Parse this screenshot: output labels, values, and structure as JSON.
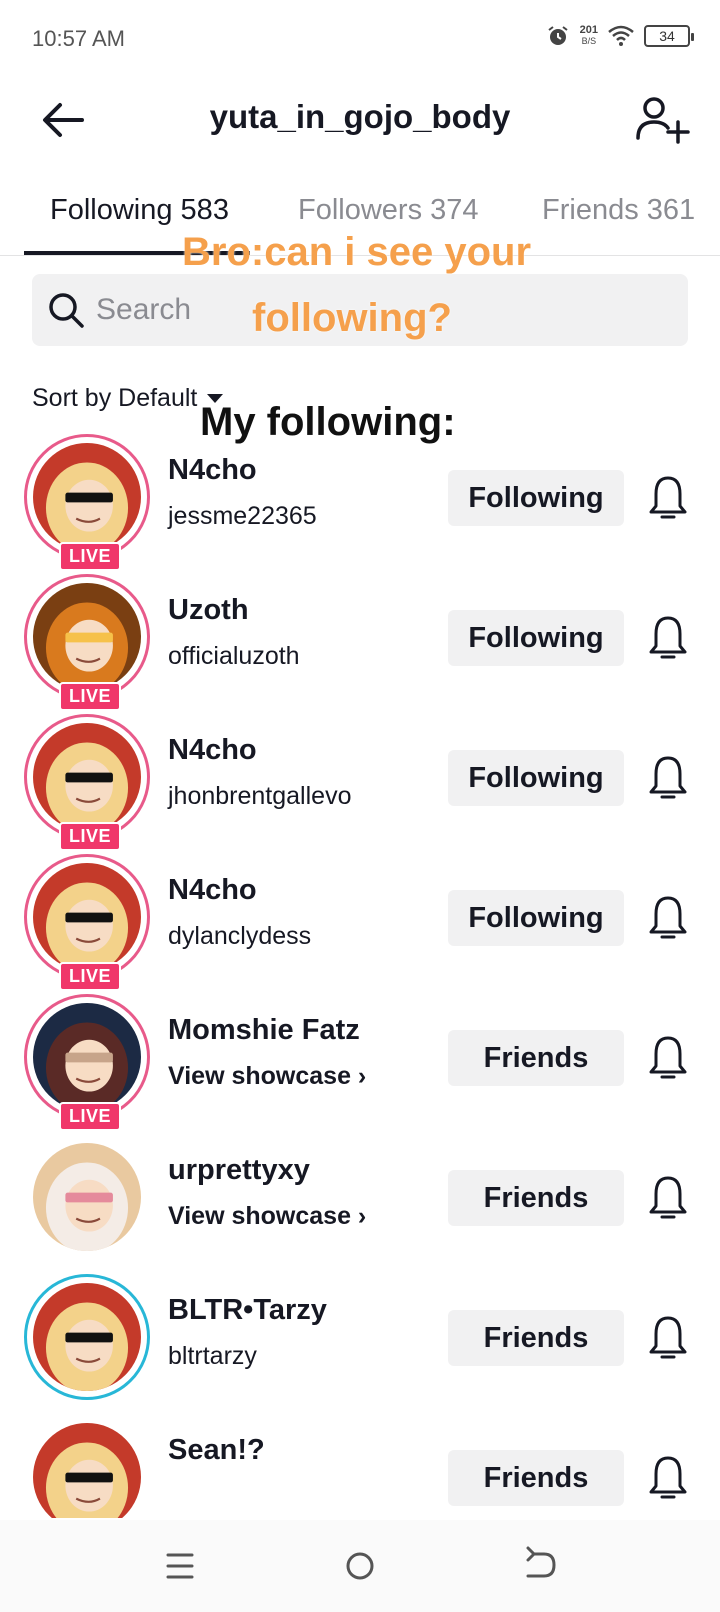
{
  "status_bar": {
    "time": "10:57 AM",
    "net_speed_value": "201",
    "net_speed_unit": "B/S",
    "battery": "34"
  },
  "header": {
    "title": "yuta_in_gojo_body"
  },
  "tabs": [
    {
      "label": "Following 583",
      "active": true
    },
    {
      "label": "Followers 374",
      "active": false
    },
    {
      "label": "Friends 361",
      "active": false
    }
  ],
  "search": {
    "placeholder": "Search"
  },
  "sort": {
    "label": "Sort by Default"
  },
  "overlay": {
    "line1": "Bro:can i see your",
    "line2": "following?",
    "line3": "My following:"
  },
  "list": [
    {
      "name": "N4cho",
      "sub": "jessme22365",
      "showcase": false,
      "live": true,
      "live_label": "LIVE",
      "button": "Following",
      "ring": "pink"
    },
    {
      "name": "Uzoth",
      "sub": "officialuzoth",
      "showcase": false,
      "live": true,
      "live_label": "LIVE",
      "button": "Following",
      "ring": "pink"
    },
    {
      "name": "N4cho",
      "sub": "jhonbrentgallevo",
      "showcase": false,
      "live": true,
      "live_label": "LIVE",
      "button": "Following",
      "ring": "pink"
    },
    {
      "name": "N4cho",
      "sub": "dylanclydess",
      "showcase": false,
      "live": true,
      "live_label": "LIVE",
      "button": "Following",
      "ring": "pink"
    },
    {
      "name": "Momshie Fatz",
      "sub": "View showcase ›",
      "showcase": true,
      "live": true,
      "live_label": "LIVE",
      "button": "Friends",
      "ring": "pink"
    },
    {
      "name": "urprettyxy",
      "sub": "View showcase ›",
      "showcase": true,
      "live": false,
      "button": "Friends",
      "ring": "none"
    },
    {
      "name": "BLTR•Tarzy",
      "sub": "bltrtarzy",
      "showcase": false,
      "live": false,
      "button": "Friends",
      "ring": "blue"
    },
    {
      "name": "Sean!?",
      "sub": "",
      "showcase": false,
      "live": false,
      "button": "Friends",
      "ring": "none"
    }
  ],
  "colors": {
    "live": "#f0376a",
    "ring_pink": "#e85a8a",
    "ring_blue": "#28b7d7",
    "overlay_orange": "#f5a04c",
    "button_bg": "#f1f1f2"
  },
  "icons": {
    "back": "arrow-left-icon",
    "add_user": "person-plus-icon",
    "search": "magnifier-icon",
    "bell": "bell-icon",
    "nav_menu": "menu-icon",
    "nav_home": "circle-home-icon",
    "nav_back": "return-icon"
  }
}
